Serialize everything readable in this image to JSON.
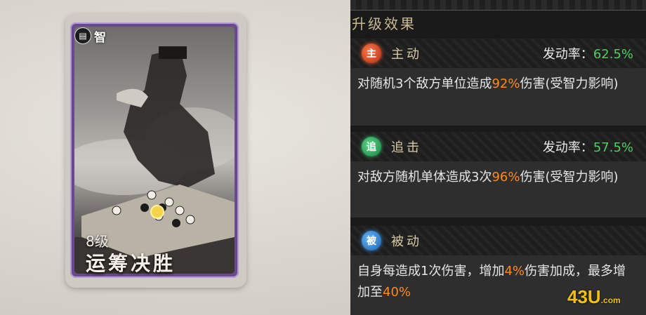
{
  "card": {
    "badge_label": "智",
    "level": "8级",
    "name": "运筹决胜"
  },
  "panel": {
    "title": "升级效果"
  },
  "skills": [
    {
      "icon_char": "主",
      "icon": "fire-skill-icon",
      "type": "主动",
      "rate_label": "发动率：",
      "rate_value": "62.5%",
      "desc_a": "对随机3个敌方单位造成",
      "desc_hl": "92%",
      "desc_b": "伤害(受智力影响)"
    },
    {
      "icon_char": "追",
      "icon": "leaf-skill-icon",
      "type": "追击",
      "rate_label": "发动率：",
      "rate_value": "57.5%",
      "desc_a": "对敌方随机单体造成3次",
      "desc_hl": "96%",
      "desc_b": "伤害(受智力影响)"
    },
    {
      "icon_char": "被",
      "icon": "water-skill-icon",
      "type": "被动",
      "desc_a": "自身每造成1次伤害，增加",
      "desc_hl": "4%",
      "desc_b": "伤害加成，最多增加至",
      "desc_hl2": "40%"
    }
  ],
  "watermark": {
    "main": "43U",
    "suffix": ".com"
  },
  "colors": {
    "highlight": "#ff8a1c",
    "rate": "#4fcf5f",
    "title_gold": "#c9b98f",
    "card_frame": "#6a4a8e"
  }
}
